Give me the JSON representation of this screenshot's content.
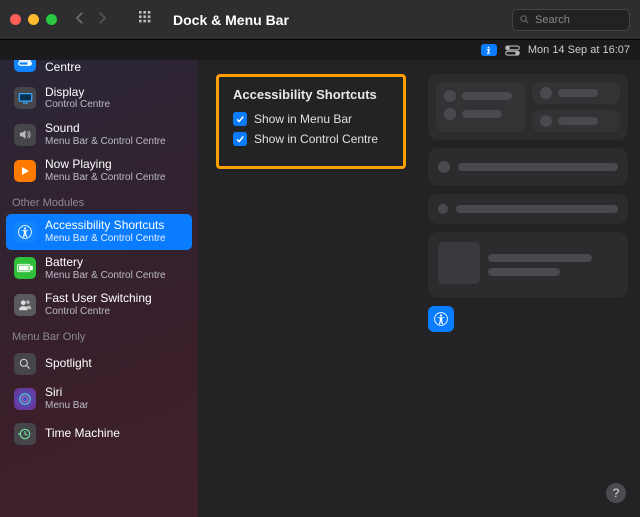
{
  "window": {
    "title": "Dock & Menu Bar",
    "search_placeholder": "Search"
  },
  "menubar": {
    "datetime": "Mon 14 Sep at  16:07"
  },
  "sidebar": {
    "top_items": [
      {
        "title": "Menu Bar & Control Centre",
        "sub": ""
      },
      {
        "title": "Display",
        "sub": "Control Centre"
      },
      {
        "title": "Sound",
        "sub": "Menu Bar & Control Centre"
      },
      {
        "title": "Now Playing",
        "sub": "Menu Bar & Control Centre"
      }
    ],
    "group1_label": "Other Modules",
    "group1_items": [
      {
        "title": "Accessibility Shortcuts",
        "sub": "Menu Bar & Control Centre"
      },
      {
        "title": "Battery",
        "sub": "Menu Bar & Control Centre"
      },
      {
        "title": "Fast User Switching",
        "sub": "Control Centre"
      }
    ],
    "group2_label": "Menu Bar Only",
    "group2_items": [
      {
        "title": "Spotlight",
        "sub": ""
      },
      {
        "title": "Siri",
        "sub": "Menu Bar"
      },
      {
        "title": "Time Machine",
        "sub": ""
      }
    ]
  },
  "panel": {
    "heading": "Accessibility Shortcuts",
    "option1": "Show in Menu Bar",
    "option2": "Show in Control Centre",
    "option1_checked": true,
    "option2_checked": true
  },
  "help_label": "?"
}
